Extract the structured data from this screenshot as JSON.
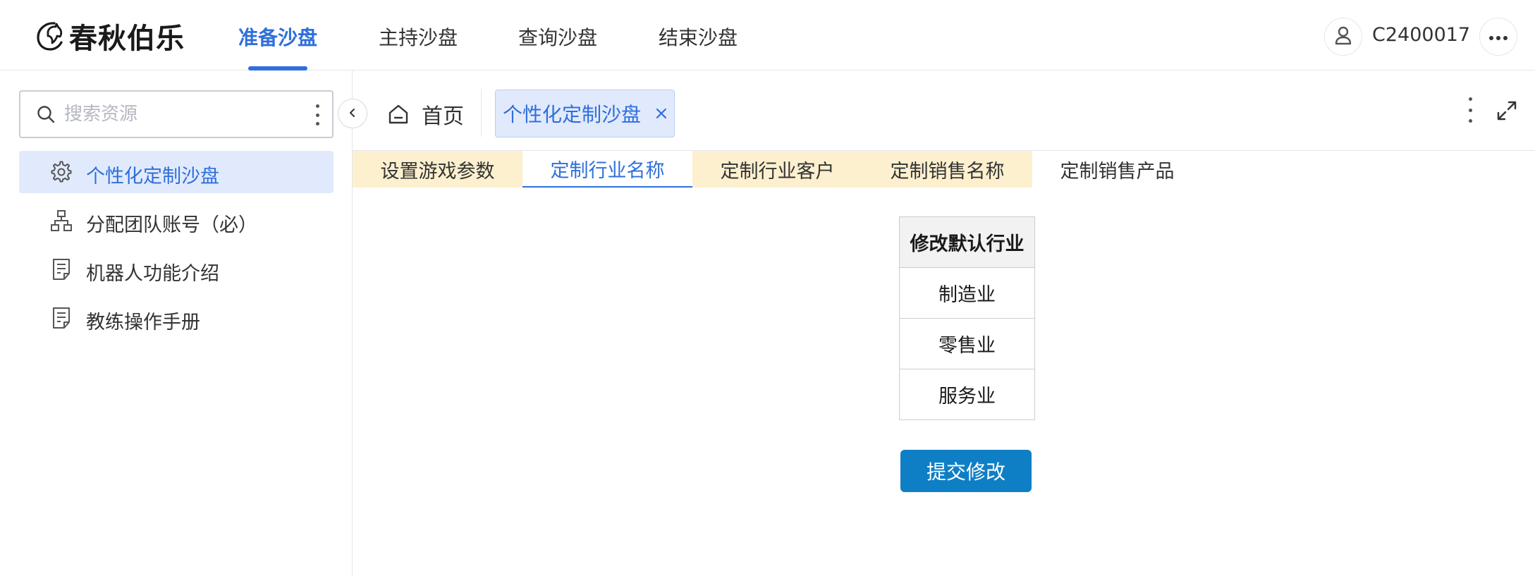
{
  "brand": {
    "name": "春秋伯乐",
    "logo_icon": "horse-head-logo"
  },
  "top_nav": {
    "items": [
      {
        "label": "准备沙盘",
        "active": true
      },
      {
        "label": "主持沙盘",
        "active": false
      },
      {
        "label": "查询沙盘",
        "active": false
      },
      {
        "label": "结束沙盘",
        "active": false
      }
    ],
    "user_id": "C2400017",
    "user_icon": "user-icon",
    "more_icon": "more-horizontal-icon"
  },
  "sidebar": {
    "search": {
      "placeholder": "搜索资源",
      "value": ""
    },
    "items": [
      {
        "label": "个性化定制沙盘",
        "icon": "gear-icon",
        "active": true
      },
      {
        "label": "分配团队账号（必）",
        "icon": "org-chart-icon",
        "active": false
      },
      {
        "label": "机器人功能介绍",
        "icon": "document-icon",
        "active": false
      },
      {
        "label": "教练操作手册",
        "icon": "document-icon",
        "active": false
      }
    ]
  },
  "tabs_bar": {
    "home_label": "首页",
    "open_tab_label": "个性化定制沙盘",
    "close_symbol": "×"
  },
  "sub_tabs": [
    {
      "label": "设置游戏参数",
      "state": "filled"
    },
    {
      "label": "定制行业名称",
      "state": "active"
    },
    {
      "label": "定制行业客户",
      "state": "filled"
    },
    {
      "label": "定制销售名称",
      "state": "filled"
    },
    {
      "label": "定制销售产品",
      "state": "plain"
    }
  ],
  "industry_table": {
    "header": "修改默认行业",
    "rows": [
      "制造业",
      "零售业",
      "服务业"
    ]
  },
  "submit_label": "提交修改",
  "colors": {
    "accent": "#2f6fdb",
    "active_bg": "#e1eafc",
    "subtab_fill": "#fdf0cf",
    "submit_bg": "#0e7fc5"
  }
}
